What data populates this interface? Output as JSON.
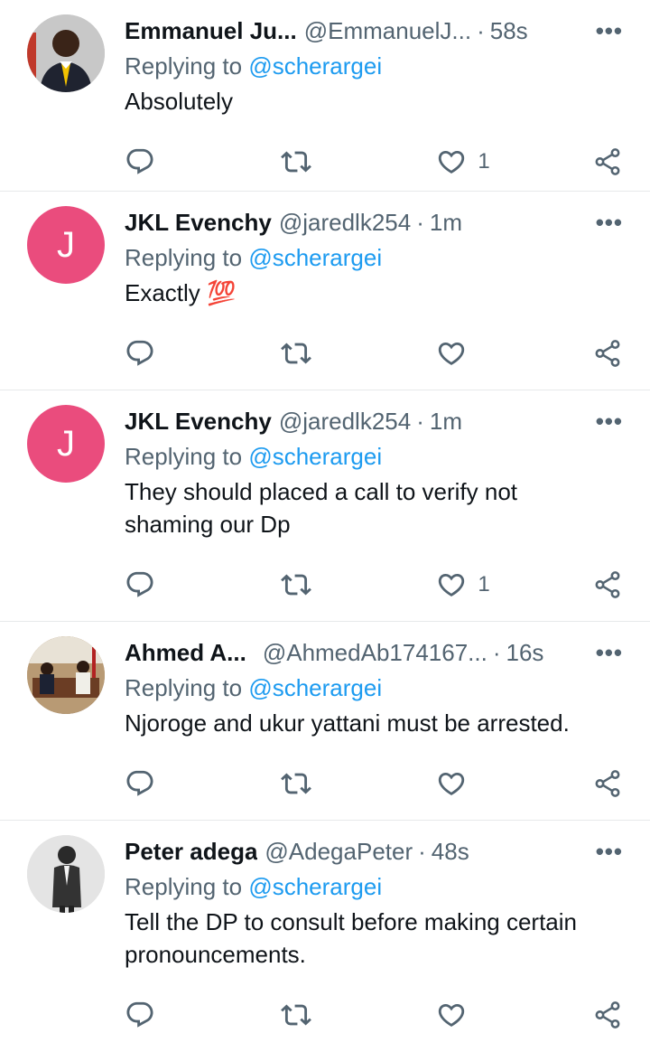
{
  "tweets": [
    {
      "name": "Emmanuel Ju...",
      "handle": "@EmmanuelJ...",
      "time": "58s",
      "avatar_letter": "",
      "reply_prefix": "Replying to",
      "reply_to": "@scherargei",
      "text": "Absolutely",
      "likes": "1"
    },
    {
      "name": "JKL Evenchy",
      "handle": "@jaredlk254",
      "time": "1m",
      "avatar_letter": "J",
      "reply_prefix": "Replying to",
      "reply_to": "@scherargei",
      "text": "Exactly 💯",
      "likes": ""
    },
    {
      "name": "JKL Evenchy",
      "handle": "@jaredlk254",
      "time": "1m",
      "avatar_letter": "J",
      "reply_prefix": "Replying to",
      "reply_to": "@scherargei",
      "text": "They should placed a call to verify not shaming our Dp",
      "likes": "1"
    },
    {
      "name": "Ahmed A...",
      "handle": "@AhmedAb174167...",
      "time": "16s",
      "avatar_letter": "",
      "reply_prefix": "Replying to",
      "reply_to": "@scherargei",
      "text": "Njoroge and ukur yattani must be arrested.",
      "likes": ""
    },
    {
      "name": "Peter adega",
      "handle": "@AdegaPeter",
      "time": "48s",
      "avatar_letter": "",
      "reply_prefix": "Replying to",
      "reply_to": "@scherargei",
      "text": "Tell the DP to consult before making certain pronouncements.",
      "likes": ""
    }
  ],
  "ui": {
    "dot": "·",
    "more": "•••"
  },
  "colors": {
    "accent": "#1d9bf0",
    "muted": "#536471",
    "avatar_pink": "#ea4c7d"
  },
  "icons": [
    "reply-icon",
    "retweet-icon",
    "like-icon",
    "share-icon",
    "more-icon"
  ]
}
